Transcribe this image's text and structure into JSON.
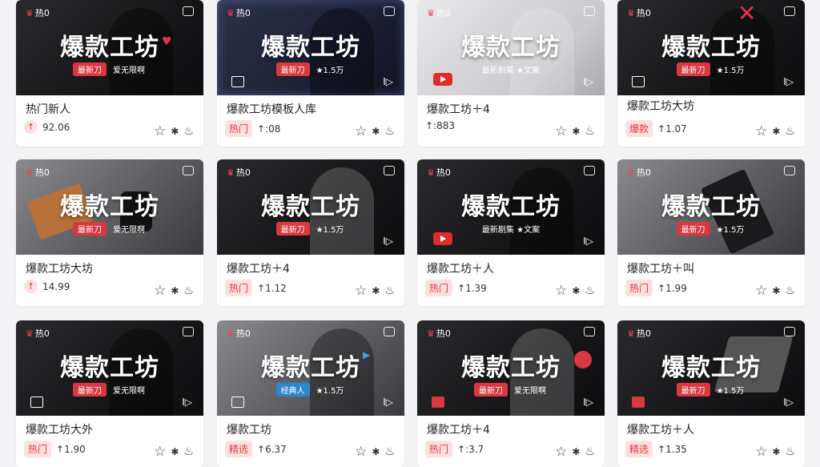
{
  "cards": [
    {
      "thumb_title": "爆款工坊",
      "hot": "热0",
      "pill": "最新刀",
      "sub": "爱无限啊",
      "title": "热门新人",
      "badge": "↑",
      "count": "92.06"
    },
    {
      "thumb_title": "爆款工坊",
      "hot": "热0",
      "pill": "最新刀",
      "sub": "★1.5万",
      "title": "爆款工坊模板人库",
      "badge": "热门",
      "count": "↑:08"
    },
    {
      "thumb_title": "爆款工坊",
      "hot": "热0",
      "pill": "",
      "sub": "最新剧集 ★文案",
      "title": "爆款工坊＋4",
      "badge": "",
      "count": "↑:883"
    },
    {
      "thumb_title": "爆款工坊",
      "hot": "热0",
      "pill": "最新刀",
      "sub": "★1.5万",
      "title": "爆款工坊大坊",
      "badge": "爆款",
      "count": "↑1.07"
    },
    {
      "thumb_title": "爆款工坊",
      "hot": "热0",
      "pill": "最新刀",
      "sub": "爱无限啊",
      "title": "爆款工坊大坊",
      "badge": "↑",
      "count": "14.99"
    },
    {
      "thumb_title": "爆款工坊",
      "hot": "热0",
      "pill": "最新刀",
      "sub": "★1.5万",
      "title": "爆款工坊＋4",
      "badge": "热门",
      "count": "↑1.12"
    },
    {
      "thumb_title": "爆款工坊",
      "hot": "热0",
      "pill": "",
      "sub": "最新剧集 ★文案",
      "title": "爆款工坊＋人",
      "badge": "热门",
      "count": "↑1.39"
    },
    {
      "thumb_title": "爆款工坊",
      "hot": "热0",
      "pill": "最新刀",
      "sub": "★1.5万",
      "title": "爆款工坊＋叫",
      "badge": "热门",
      "count": "↑1.99"
    },
    {
      "thumb_title": "爆款工坊",
      "hot": "热0",
      "pill": "最新刀",
      "sub": "爱无限啊",
      "title": "爆款工坊大外",
      "badge": "热门",
      "count": "↑1.90"
    },
    {
      "thumb_title": "爆款工坊",
      "hot": "热0",
      "pill": "经典人",
      "sub": "★1.5万",
      "title": "爆款工坊",
      "badge": "精选",
      "count": "↑6.37"
    },
    {
      "thumb_title": "爆款工坊",
      "hot": "热0",
      "pill": "最新刀",
      "sub": "爱无限啊",
      "title": "爆款工坊＋4",
      "badge": "热门",
      "count": "↑:3.7"
    },
    {
      "thumb_title": "爆款工坊",
      "hot": "热0",
      "pill": "最新刀",
      "sub": "★1.5万",
      "title": "爆款工坊＋人",
      "badge": "精选",
      "count": "↑1.35"
    }
  ],
  "colors": {
    "accent": "#d8383f",
    "badge_bg": "#fde1e1",
    "badge_text": "#e0383f"
  }
}
